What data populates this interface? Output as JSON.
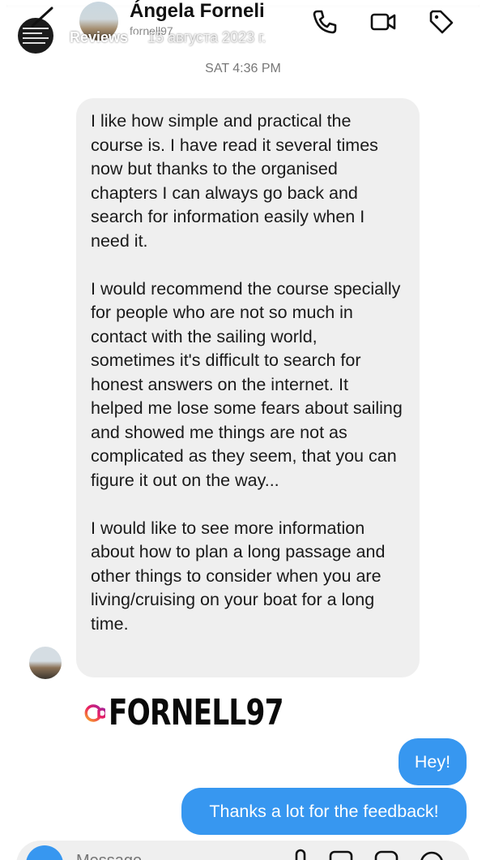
{
  "story": {
    "progress": 1.0,
    "account": "Reviews",
    "date": "15 августа 2023 г."
  },
  "header": {
    "contact_name": "Ángela Forneli",
    "contact_handle": "fornell97",
    "more_label": "...",
    "icons": [
      "back-arrow-icon",
      "phone-icon",
      "video-call-icon",
      "tag-icon",
      "close-icon"
    ]
  },
  "conversation": {
    "timestamp": "SAT 4:36 PM",
    "received_paragraphs": [
      "I like how simple and practical the course is. I have read it several times now but thanks to the organised chapters I can always go back and search for information easily when I need it.",
      "I would recommend the course specially for people who are not so much in contact with the sailing world, sometimes it's difficult to search for honest answers on the internet. It helped me lose some fears about sailing and showed me things are not as complicated as they seem, that you can figure it out on the way...",
      "I would like to see more information about how to plan a long passage and other things to consider when you are living/cruising on your boat for a long time."
    ],
    "mention_sticker": "FORNELL97",
    "sent_messages": [
      "Hey!",
      "Thanks a lot for the feedback!"
    ]
  },
  "composer": {
    "placeholder": "Message..."
  },
  "colors": {
    "sent_bubble": "#3797f0",
    "received_bubble": "#efefef"
  }
}
